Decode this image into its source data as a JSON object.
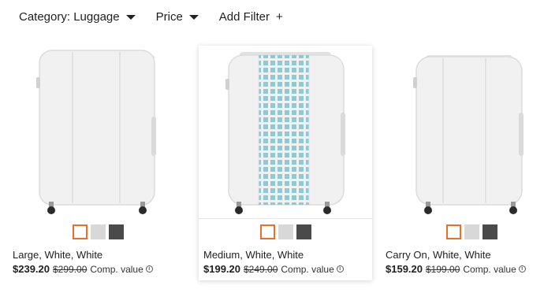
{
  "filters": {
    "category_label": "Category: Luggage",
    "price_label": "Price",
    "add_filter_label": "Add Filter",
    "add_symbol": "+"
  },
  "products": [
    {
      "name": "Large, White, White",
      "price": "$239.20",
      "old_price": "$299.00",
      "comp_label": "Comp. value",
      "pattern": "plain",
      "highlighted": false
    },
    {
      "name": "Medium, White, White",
      "price": "$199.20",
      "old_price": "$249.00",
      "comp_label": "Comp. value",
      "pattern": "teal-gingham",
      "highlighted": true
    },
    {
      "name": "Carry On, White, White",
      "price": "$159.20",
      "old_price": "$199.00",
      "comp_label": "Comp. value",
      "pattern": "plain",
      "highlighted": false
    }
  ],
  "swatch_colors": {
    "selected_border": "#e8702a",
    "light": "#d8d8d8",
    "dark": "#4a4a4a"
  },
  "accent_pattern_color": "#8fc9d4",
  "info_icon": "info-icon"
}
